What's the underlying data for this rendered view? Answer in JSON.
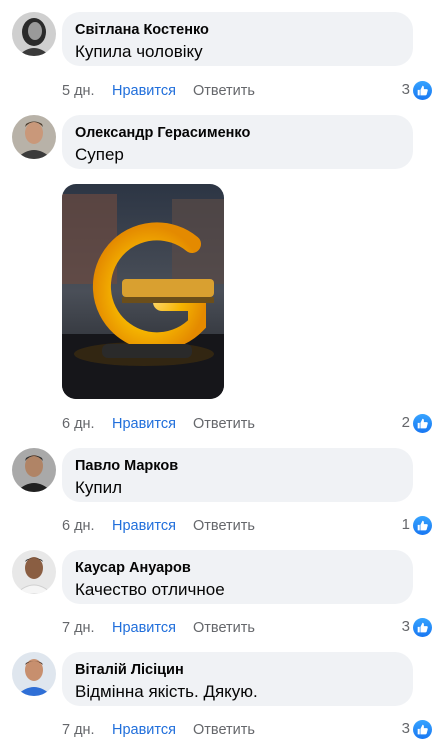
{
  "accent": "#216fdb",
  "comments": [
    {
      "author": "Світлана Костенко",
      "text": "Купила чоловіку",
      "time": "5 дн.",
      "like_label": "Нравится",
      "reply_label": "Ответить",
      "likes": "3",
      "avatar_icon": "avatar-woman"
    },
    {
      "author": "Олександр Герасименко",
      "text": "Супер",
      "time": "6 дн.",
      "like_label": "Нравится",
      "reply_label": "Ответить",
      "likes": "2",
      "avatar_icon": "avatar-man",
      "photo": "g-shaped-lamp-photo"
    },
    {
      "author": "Павло Марков",
      "text": "Купил",
      "time": "6 дн.",
      "like_label": "Нравится",
      "reply_label": "Ответить",
      "likes": "1",
      "avatar_icon": "avatar-man"
    },
    {
      "author": "Каусар Ануаров",
      "text": "Качество отличное",
      "time": "7 дн.",
      "like_label": "Нравится",
      "reply_label": "Ответить",
      "likes": "3",
      "avatar_icon": "avatar-man"
    },
    {
      "author": "Віталій Лісіцин",
      "text": "Відмінна якість. Дякую.",
      "time": "7 дн.",
      "like_label": "Нравится",
      "reply_label": "Ответить",
      "likes": "3",
      "avatar_icon": "avatar-man"
    }
  ]
}
